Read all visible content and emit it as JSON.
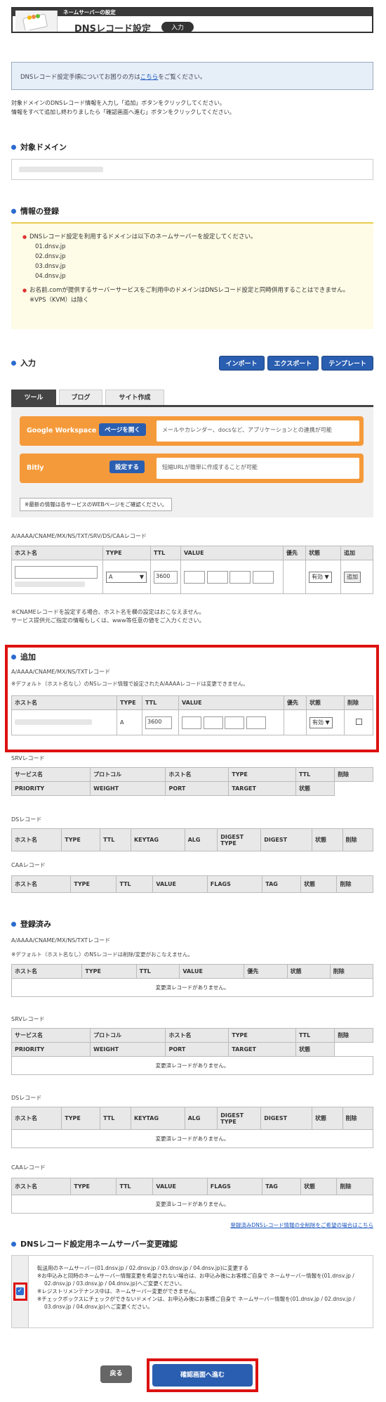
{
  "header": {
    "bar": "ネームサーバーの設定",
    "title": "DNSレコード設定",
    "badge": "入力"
  },
  "notice": {
    "prefix": "DNSレコード設定手順についてお困りの方は",
    "link": "こちら",
    "suffix": "をご覧ください。"
  },
  "intro": [
    "対象ドメインのDNSレコード情報を入力し「追加」ボタンをクリックしてください。",
    "情報をすべて追加し終わりましたら「確認画面へ進む」ボタンをクリックしてください。"
  ],
  "target": {
    "title": "対象ドメイン"
  },
  "info": {
    "title": "情報の登録",
    "item1": "DNSレコード設定を利用するドメインは以下のネームサーバーを設定してください。",
    "ns": [
      "01.dnsv.jp",
      "02.dnsv.jp",
      "03.dnsv.jp",
      "04.dnsv.jp"
    ],
    "item2": "お名前.comが提供するサーバーサービスをご利用中のドメインはDNSレコード設定と同時併用することはできません。",
    "item2b": "※VPS（KVM）は除く"
  },
  "input": {
    "title": "入力",
    "buttons": [
      "インポート",
      "エクスポート",
      "テンプレート"
    ],
    "tabs": [
      "ツール",
      "ブログ",
      "サイト作成"
    ]
  },
  "tools": [
    {
      "name": "Google Workspace",
      "button": "ページを開く",
      "desc": "メールやカレンダー、docsなど、アプリケーションとの連携が可能"
    },
    {
      "name": "Bitly",
      "button": "設定する",
      "desc": "短縮URLが簡単に作成することが可能"
    }
  ],
  "tool_note": "※最新の情報は各サービスのWEBページをご確認ください。",
  "entry": {
    "label": "A/AAAA/CNAME/MX/NS/TXT/SRV/DS/CAAレコード",
    "cols": [
      "ホスト名",
      "TYPE",
      "TTL",
      "VALUE",
      "優先",
      "状態",
      "追加"
    ],
    "type": "A",
    "ttl": "3600",
    "status": "有効",
    "add": "追加",
    "note1": "※CNAMEレコードを設定する場合、ホスト名を欄の設定はおこなえません。",
    "note2": "サービス提供元ご指定の情報もしくは、www等任意の値をご入力ください。"
  },
  "added": {
    "title": "追加",
    "label": "A/AAAA/CNAME/MX/NS/TXTレコード",
    "note": "※デフォルト（ホスト名なし）のNSレコード情報で設定されたA/AAAAレコードは変更できません。",
    "cols": [
      "ホスト名",
      "TYPE",
      "TTL",
      "VALUE",
      "優先",
      "状態",
      "削除"
    ],
    "type": "A",
    "ttl": "3600",
    "status": "有効"
  },
  "srv": {
    "label": "SRVレコード",
    "row1": [
      "サービス名",
      "プロトコル",
      "ホスト名",
      "TYPE",
      "TTL",
      "削除"
    ],
    "row2": [
      "PRIORITY",
      "WEIGHT",
      "PORT",
      "TARGET",
      "状態",
      ""
    ]
  },
  "ds": {
    "label": "DSレコード",
    "cols": [
      "ホスト名",
      "TYPE",
      "TTL",
      "KEYTAG",
      "ALG",
      "DIGEST TYPE",
      "DIGEST",
      "状態",
      "削除"
    ]
  },
  "caa": {
    "label": "CAAレコード",
    "cols": [
      "ホスト名",
      "TYPE",
      "TTL",
      "VALUE",
      "FLAGS",
      "TAG",
      "状態",
      "削除"
    ]
  },
  "registered": {
    "title": "登録済み",
    "label": "A/AAAA/CNAME/MX/NS/TXTレコード",
    "note": "※デフォルト（ホスト名なし）のNSレコードは削除/変更がおこなえません。",
    "cols": [
      "ホスト名",
      "TYPE",
      "TTL",
      "VALUE",
      "優先",
      "状態",
      "削除"
    ],
    "empty": "変更済レコードがありません。",
    "link": "登録済みDNSレコード情報の全削除をご希望の場合はこちら"
  },
  "confirm": {
    "title": "DNSレコード設定用ネームサーバー変更確認",
    "line1": "転送用のネームサーバー(01.dnsv.jp / 02.dnsv.jp / 03.dnsv.jp / 04.dnsv.jp)に変更する",
    "line2": "※お申込みと同時のネームサーバー情報変更を希望されない場合は、お申込み後にお客様ご自身で ネームサーバー情報を(01.dnsv.jp / 02.dnsv.jp / 03.dnsv.jp / 04.dnsv.jp)へご変更ください。",
    "line3": "※レジストリメンテナンス中は、ネームサーバー変更ができません。",
    "line4": "※チェックボックスにチェックができないドメインは、お申込み後にお客様ご自身で ネームサーバー情報を(01.dnsv.jp / 02.dnsv.jp / 03.dnsv.jp / 04.dnsv.jp)へご変更ください。"
  },
  "footer": {
    "back": "戻る",
    "next": "確認画面へ進む"
  }
}
